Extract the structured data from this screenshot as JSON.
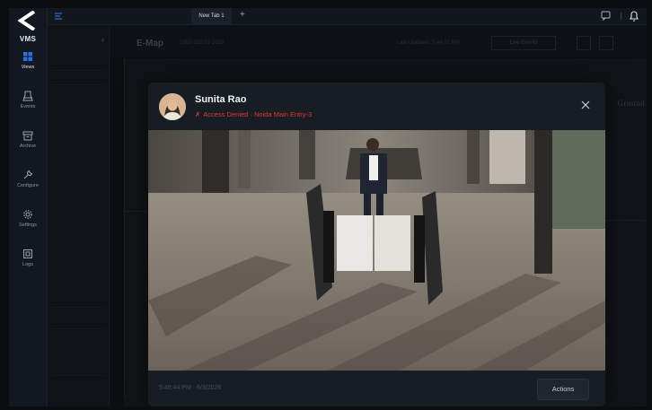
{
  "app": {
    "brand": "VMS"
  },
  "nav": {
    "items": [
      {
        "label": "Views",
        "icon": "grid-icon",
        "active": true
      },
      {
        "label": "Events",
        "icon": "events-icon"
      },
      {
        "label": "Archive",
        "icon": "archive-icon"
      },
      {
        "label": "Configure",
        "icon": "wrench-icon"
      },
      {
        "label": "Settings",
        "icon": "gear-icon"
      },
      {
        "label": "Logs",
        "icon": "logs-icon"
      }
    ]
  },
  "tabs": {
    "active_label": "New Tab 1",
    "add": "+"
  },
  "background": {
    "emap_title": "E-Map",
    "emap_id": "1002-202-01-2026",
    "emap_date": "Last Updated: 5:44:02 PM",
    "live_button": "Live Events",
    "map_label": "Ground"
  },
  "modal": {
    "person_name": "Sunita Rao",
    "status_mark": "✗",
    "status_text": "Access Denied · Noida Main Entry-3",
    "timestamp": "5:45:44 PM · 6/3/2026",
    "actions_label": "Actions"
  },
  "colors": {
    "accent": "#2f6fdb",
    "denied": "#e53935",
    "nav_bg": "#121721"
  }
}
